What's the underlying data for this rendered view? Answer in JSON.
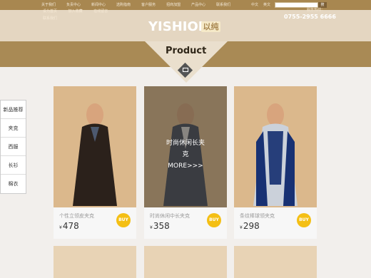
{
  "topnav": [
    "关于我们",
    "负责中心",
    "新闻中心",
    "选购指南",
    "客户服务",
    "招商加盟",
    "产品中心",
    "联系我们"
  ],
  "language": [
    "中文",
    "英文"
  ],
  "search": {
    "placeholder": "",
    "button": "搜"
  },
  "brand": {
    "logo_text": "YISHION",
    "logo_chinese": "以纯"
  },
  "mainnav": {
    "links": [
      "设为首页",
      "加入收藏",
      "在线留言",
      "联系我们"
    ],
    "hotline_label": "服务热线：",
    "hotline": "0755-2955 6666"
  },
  "section": {
    "title": "Product"
  },
  "sidebar": {
    "items": [
      "新品推荐",
      "夹克",
      "西服",
      "长衫",
      "棉衣"
    ]
  },
  "products": [
    {
      "name": "个性立领皮夹克",
      "currency": "¥",
      "price": "478",
      "buy": "BUY"
    },
    {
      "name": "时尚休闲中长夹克",
      "currency": "¥",
      "price": "358",
      "buy": "BUY",
      "overlay_title": "时尚休闲长夹克",
      "overlay_more": "MORE>>>"
    },
    {
      "name": "条纹棒球领夹克",
      "currency": "¥",
      "price": "298",
      "buy": "BUY"
    }
  ],
  "colors": {
    "gold": "#a98a55",
    "yellow": "#f4bf14"
  }
}
